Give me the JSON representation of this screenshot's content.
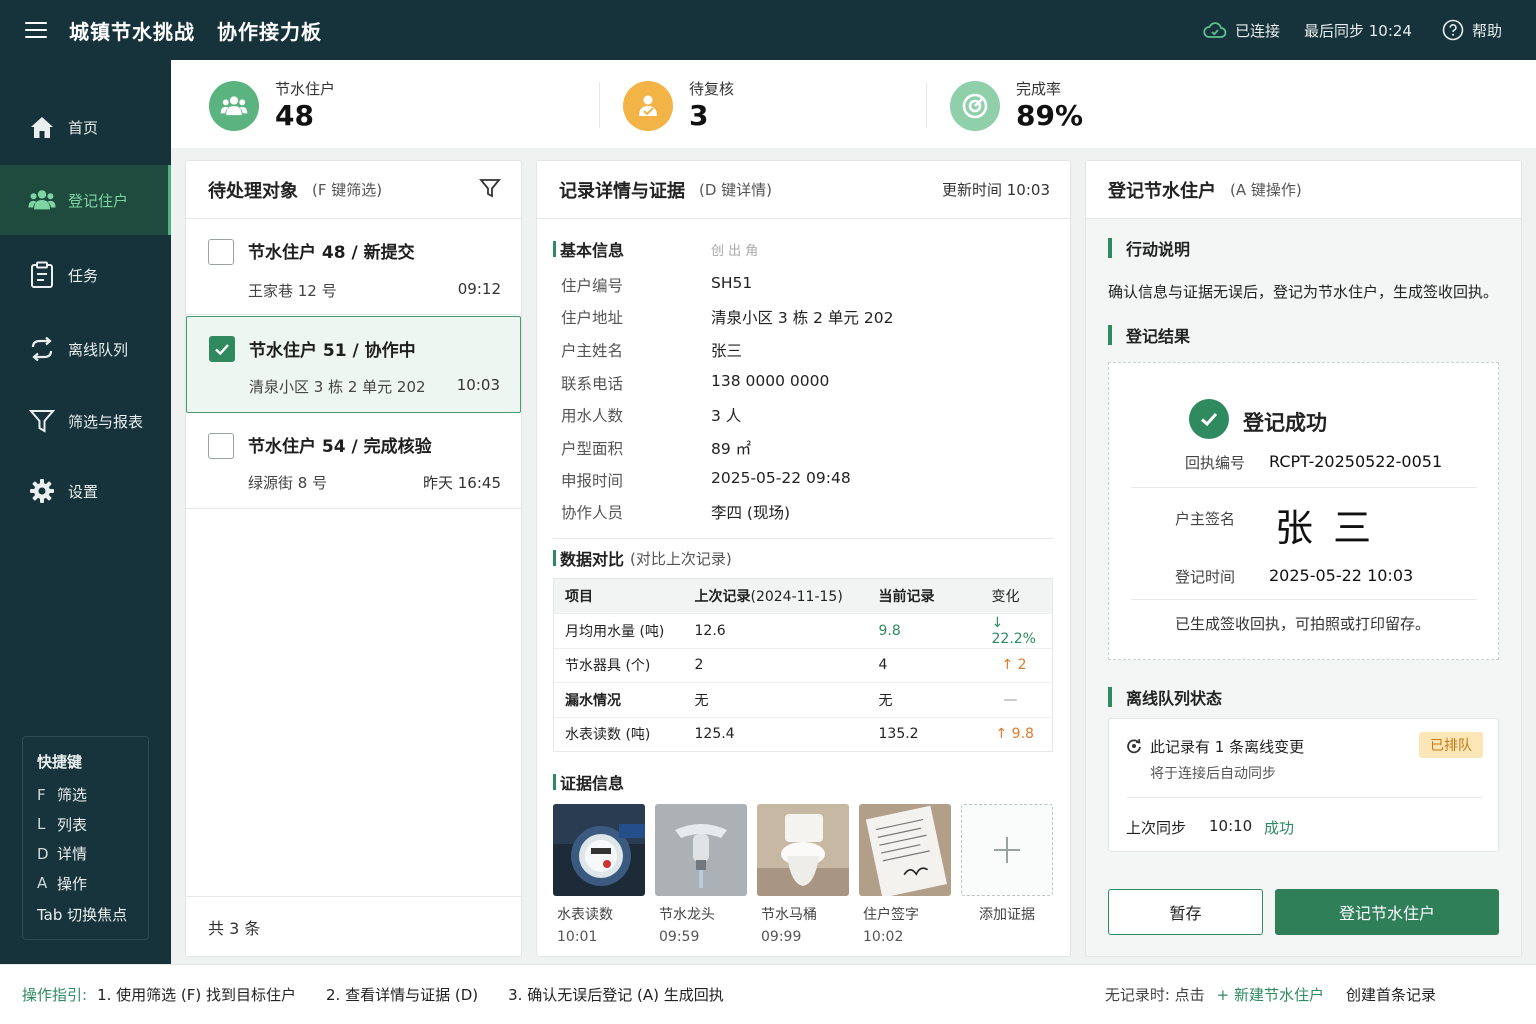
{
  "app": {
    "title": "城镇节水挑战",
    "subtitle": "协作接力板",
    "connection": "已连接",
    "last_sync": "最后同步  10:24",
    "help": "帮助"
  },
  "sidebar": {
    "items": [
      {
        "label": "首页",
        "icon": "home-icon"
      },
      {
        "label": "登记住户",
        "icon": "users-icon",
        "active": true
      },
      {
        "label": "任务",
        "icon": "clipboard-icon"
      },
      {
        "label": "离线队列",
        "icon": "sync-icon"
      },
      {
        "label": "筛选与报表",
        "icon": "filter-icon"
      },
      {
        "label": "设置",
        "icon": "gear-icon"
      }
    ],
    "shortcuts": {
      "title": "快捷键",
      "rows": [
        {
          "key": "F",
          "label": "筛选"
        },
        {
          "key": "L",
          "label": "列表"
        },
        {
          "key": "D",
          "label": "详情"
        },
        {
          "key": "A",
          "label": "操作"
        }
      ],
      "tab": "Tab  切换焦点"
    }
  },
  "stats": [
    {
      "label": "节水住户",
      "value": "48"
    },
    {
      "label": "待复核",
      "value": "3"
    },
    {
      "label": "完成率",
      "value": "89%"
    }
  ],
  "pending": {
    "title": "待处理对象",
    "hint": "(F 键筛选)",
    "items": [
      {
        "title": "节水住户 48 / 新提交",
        "addr": "王家巷 12 号",
        "time": "09:12",
        "checked": false
      },
      {
        "title": "节水住户 51 / 协作中",
        "addr": "清泉小区 3 栋 2 单元 202",
        "time": "10:03",
        "checked": true
      },
      {
        "title": "节水住户 54 / 完成核验",
        "addr": "绿源街 8 号",
        "time": "昨天 16:45",
        "checked": false
      }
    ],
    "total": "共 3 条"
  },
  "detail": {
    "title": "记录详情与证据",
    "hint": "(D 键详情)",
    "updated": "更新时间  10:03",
    "basic_title": "基本信息",
    "basic_hint": "创 出 角",
    "fields": [
      {
        "label": "住户编号",
        "value": "SH51"
      },
      {
        "label": "住户地址",
        "value": "清泉小区 3 栋 2 单元 202"
      },
      {
        "label": "户主姓名",
        "value": "张三"
      },
      {
        "label": "联系电话",
        "value": "138 0000 0000"
      },
      {
        "label": "用水人数",
        "value": "3 人"
      },
      {
        "label": "户型面积",
        "value": "89 ㎡"
      },
      {
        "label": "申报时间",
        "value": "2025-05-22 09:48"
      },
      {
        "label": "协作人员",
        "value": "李四 (现场)"
      }
    ],
    "compare_title": "数据对比",
    "compare_hint": "(对比上次记录)",
    "compare_head": {
      "item": "项目",
      "prev": "上次记录",
      "prev_date": "(2024-11-15)",
      "cur": "当前记录",
      "change": "变化"
    },
    "compare_rows": [
      {
        "item": "月均用水量 (吨)",
        "prev": "12.6",
        "cur": "9.8",
        "change": "↓ 22.2%",
        "tone": "good"
      },
      {
        "item": "节水器具 (个)",
        "prev": "2",
        "cur": "4",
        "change": "↑ 2",
        "tone": "warn"
      },
      {
        "item": "漏水情况",
        "prev": "无",
        "cur": "无",
        "change": "—",
        "tone": "neutral"
      },
      {
        "item": "水表读数 (吨)",
        "prev": "125.4",
        "cur": "135.2",
        "change": "↑ 9.8",
        "tone": "warn"
      }
    ],
    "evidence_title": "证据信息",
    "evidence": [
      {
        "name": "水表读数",
        "time": "10:01"
      },
      {
        "name": "节水龙头",
        "time": "09:59"
      },
      {
        "name": "节水马桶",
        "time": "09:99"
      },
      {
        "name": "住户签字",
        "time": "10:02"
      }
    ],
    "add_evidence": "添加证据"
  },
  "register": {
    "title": "登记节水住户",
    "hint": "(A 键操作)",
    "action_title": "行动说明",
    "action_text": "确认信息与证据无误后，登记为节水住户，生成签收回执。",
    "result_title": "登记结果",
    "success": "登记成功",
    "receipt_label": "回执编号",
    "receipt_no": "RCPT-20250522-0051",
    "sign_label": "户主签名",
    "signature": "张 三",
    "time_label": "登记时间",
    "time_value": "2025-05-22  10:03",
    "receipt_note": "已生成签收回执，可拍照或打印留存。",
    "queue_title": "离线队列状态",
    "queue_msg": "此记录有 1 条离线变更",
    "queue_badge": "已排队",
    "queue_sub": "将于连接后自动同步",
    "last_sync_label": "上次同步",
    "last_sync_time": "10:10",
    "last_sync_status": "成功",
    "save_button": "暂存",
    "register_button": "登记节水住户"
  },
  "footer": {
    "guide_label": "操作指引:",
    "step1": "1.  使用筛选 (F) 找到目标住户",
    "step2": "2.  查看详情与证据 (D)",
    "step3": "3.  确认无误后登记 (A) 生成回执",
    "empty_label": "无记录时:  点击",
    "new_link": "+ 新建节水住户",
    "empty_tail": "创建首条记录"
  },
  "colors": {
    "topbar": "#16323a",
    "accent": "#2f8a5f",
    "good": "#2f8a5f",
    "warn": "#e07a2a"
  }
}
